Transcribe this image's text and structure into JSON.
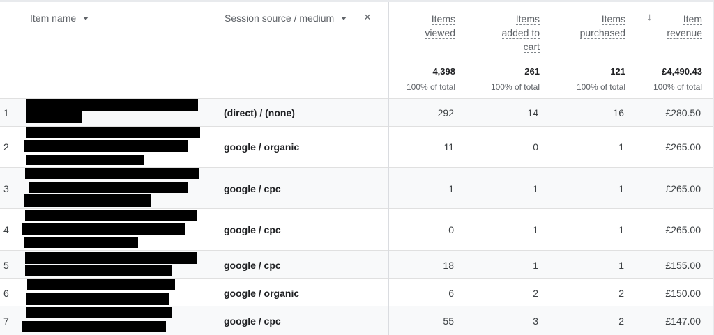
{
  "header": {
    "dimension_1": "Item name",
    "dimension_2": "Session source / medium",
    "close_symbol": "×",
    "sort_symbol": "↓",
    "metrics": [
      {
        "lines": [
          "Items",
          "viewed"
        ]
      },
      {
        "lines": [
          "Items",
          "added to",
          "cart"
        ]
      },
      {
        "lines": [
          "Items",
          "purchased"
        ]
      },
      {
        "lines": [
          "Item",
          "revenue"
        ]
      }
    ]
  },
  "totals": {
    "values": [
      "4,398",
      "261",
      "121",
      "£4,490.43"
    ],
    "percents": [
      "100% of total",
      "100% of total",
      "100% of total",
      "100% of total"
    ]
  },
  "rows": [
    {
      "num": "1",
      "source": "(direct) / (none)",
      "viewed": "292",
      "added": "14",
      "purchased": "16",
      "revenue": "£280.50"
    },
    {
      "num": "2",
      "source": "google / organic",
      "viewed": "11",
      "added": "0",
      "purchased": "1",
      "revenue": "£265.00"
    },
    {
      "num": "3",
      "source": "google / cpc",
      "viewed": "1",
      "added": "1",
      "purchased": "1",
      "revenue": "£265.00"
    },
    {
      "num": "4",
      "source": "google / cpc",
      "viewed": "0",
      "added": "1",
      "purchased": "1",
      "revenue": "£265.00"
    },
    {
      "num": "5",
      "source": "google / cpc",
      "viewed": "18",
      "added": "1",
      "purchased": "1",
      "revenue": "£155.00"
    },
    {
      "num": "6",
      "source": "google / organic",
      "viewed": "6",
      "added": "2",
      "purchased": "2",
      "revenue": "£150.00"
    },
    {
      "num": "7",
      "source": "google / cpc",
      "viewed": "55",
      "added": "3",
      "purchased": "2",
      "revenue": "£147.00"
    }
  ],
  "colors": {
    "redaction": "#000000",
    "row_shade": "#f8f9fa",
    "divider": "#dadce0"
  }
}
